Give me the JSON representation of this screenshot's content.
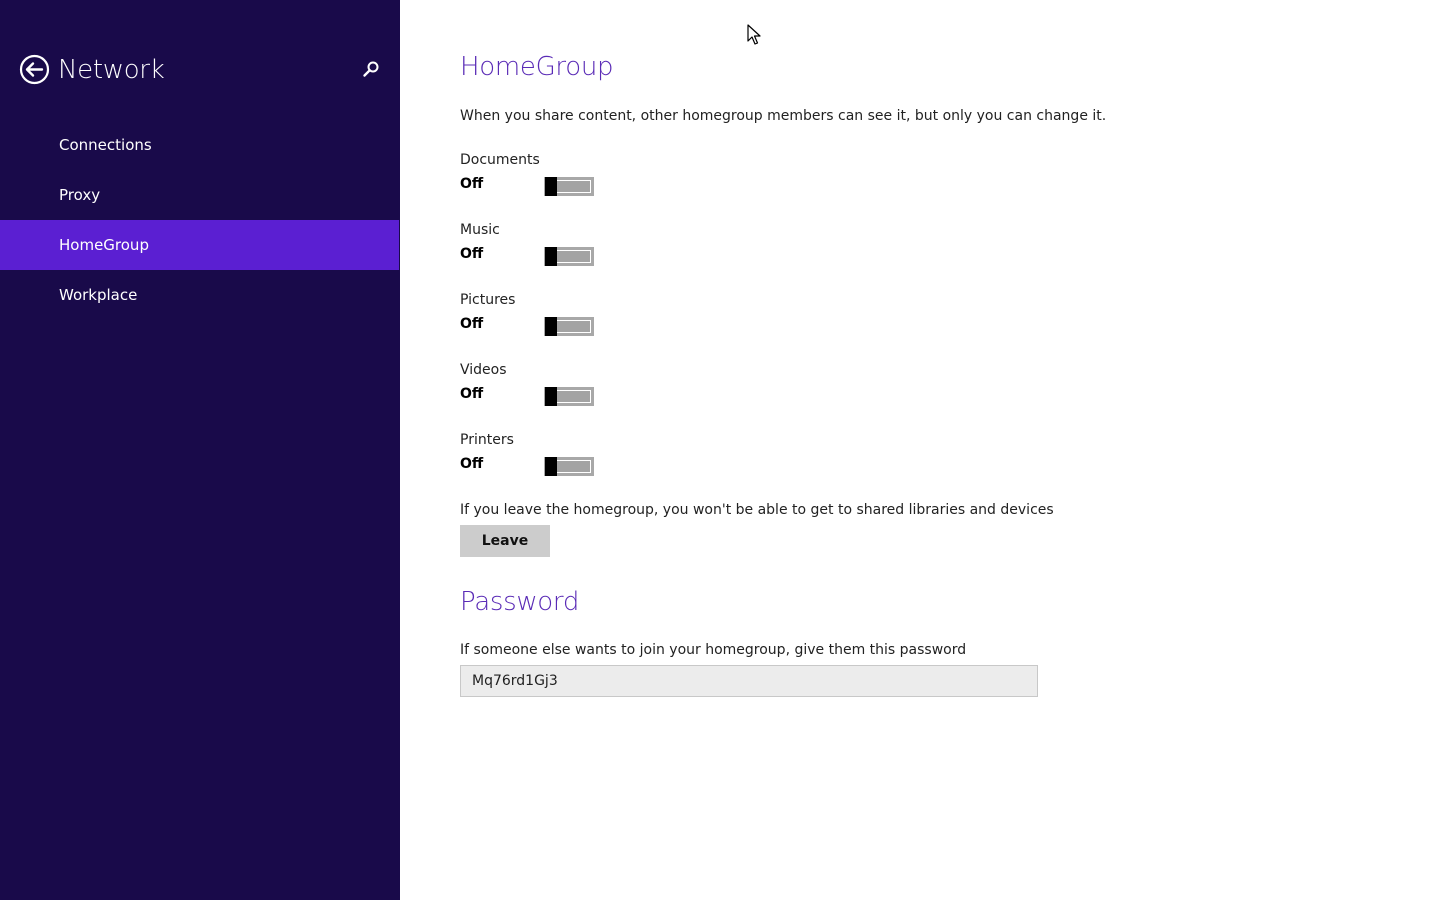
{
  "sidebar": {
    "title": "Network",
    "back_icon": "back-arrow-icon",
    "search_icon": "search-icon",
    "items": [
      {
        "label": "Connections",
        "selected": false
      },
      {
        "label": "Proxy",
        "selected": false
      },
      {
        "label": "HomeGroup",
        "selected": true
      },
      {
        "label": "Workplace",
        "selected": false
      }
    ]
  },
  "homegroup": {
    "heading": "HomeGroup",
    "description": "When you share content, other homegroup members can see it, but only you can change it.",
    "toggles": [
      {
        "label": "Documents",
        "state": "Off"
      },
      {
        "label": "Music",
        "state": "Off"
      },
      {
        "label": "Pictures",
        "state": "Off"
      },
      {
        "label": "Videos",
        "state": "Off"
      },
      {
        "label": "Printers",
        "state": "Off"
      }
    ],
    "leave_description": "If you leave the homegroup, you won't be able to get to shared libraries and devices",
    "leave_button": "Leave"
  },
  "password": {
    "heading": "Password",
    "description": "If someone else wants to join your homegroup, give them this password",
    "value": "Mq76rd1Gj3"
  },
  "colors": {
    "sidebar_bg": "#190a4a",
    "selected_bg": "#5b1fd2",
    "heading": "#5a2bb6"
  }
}
